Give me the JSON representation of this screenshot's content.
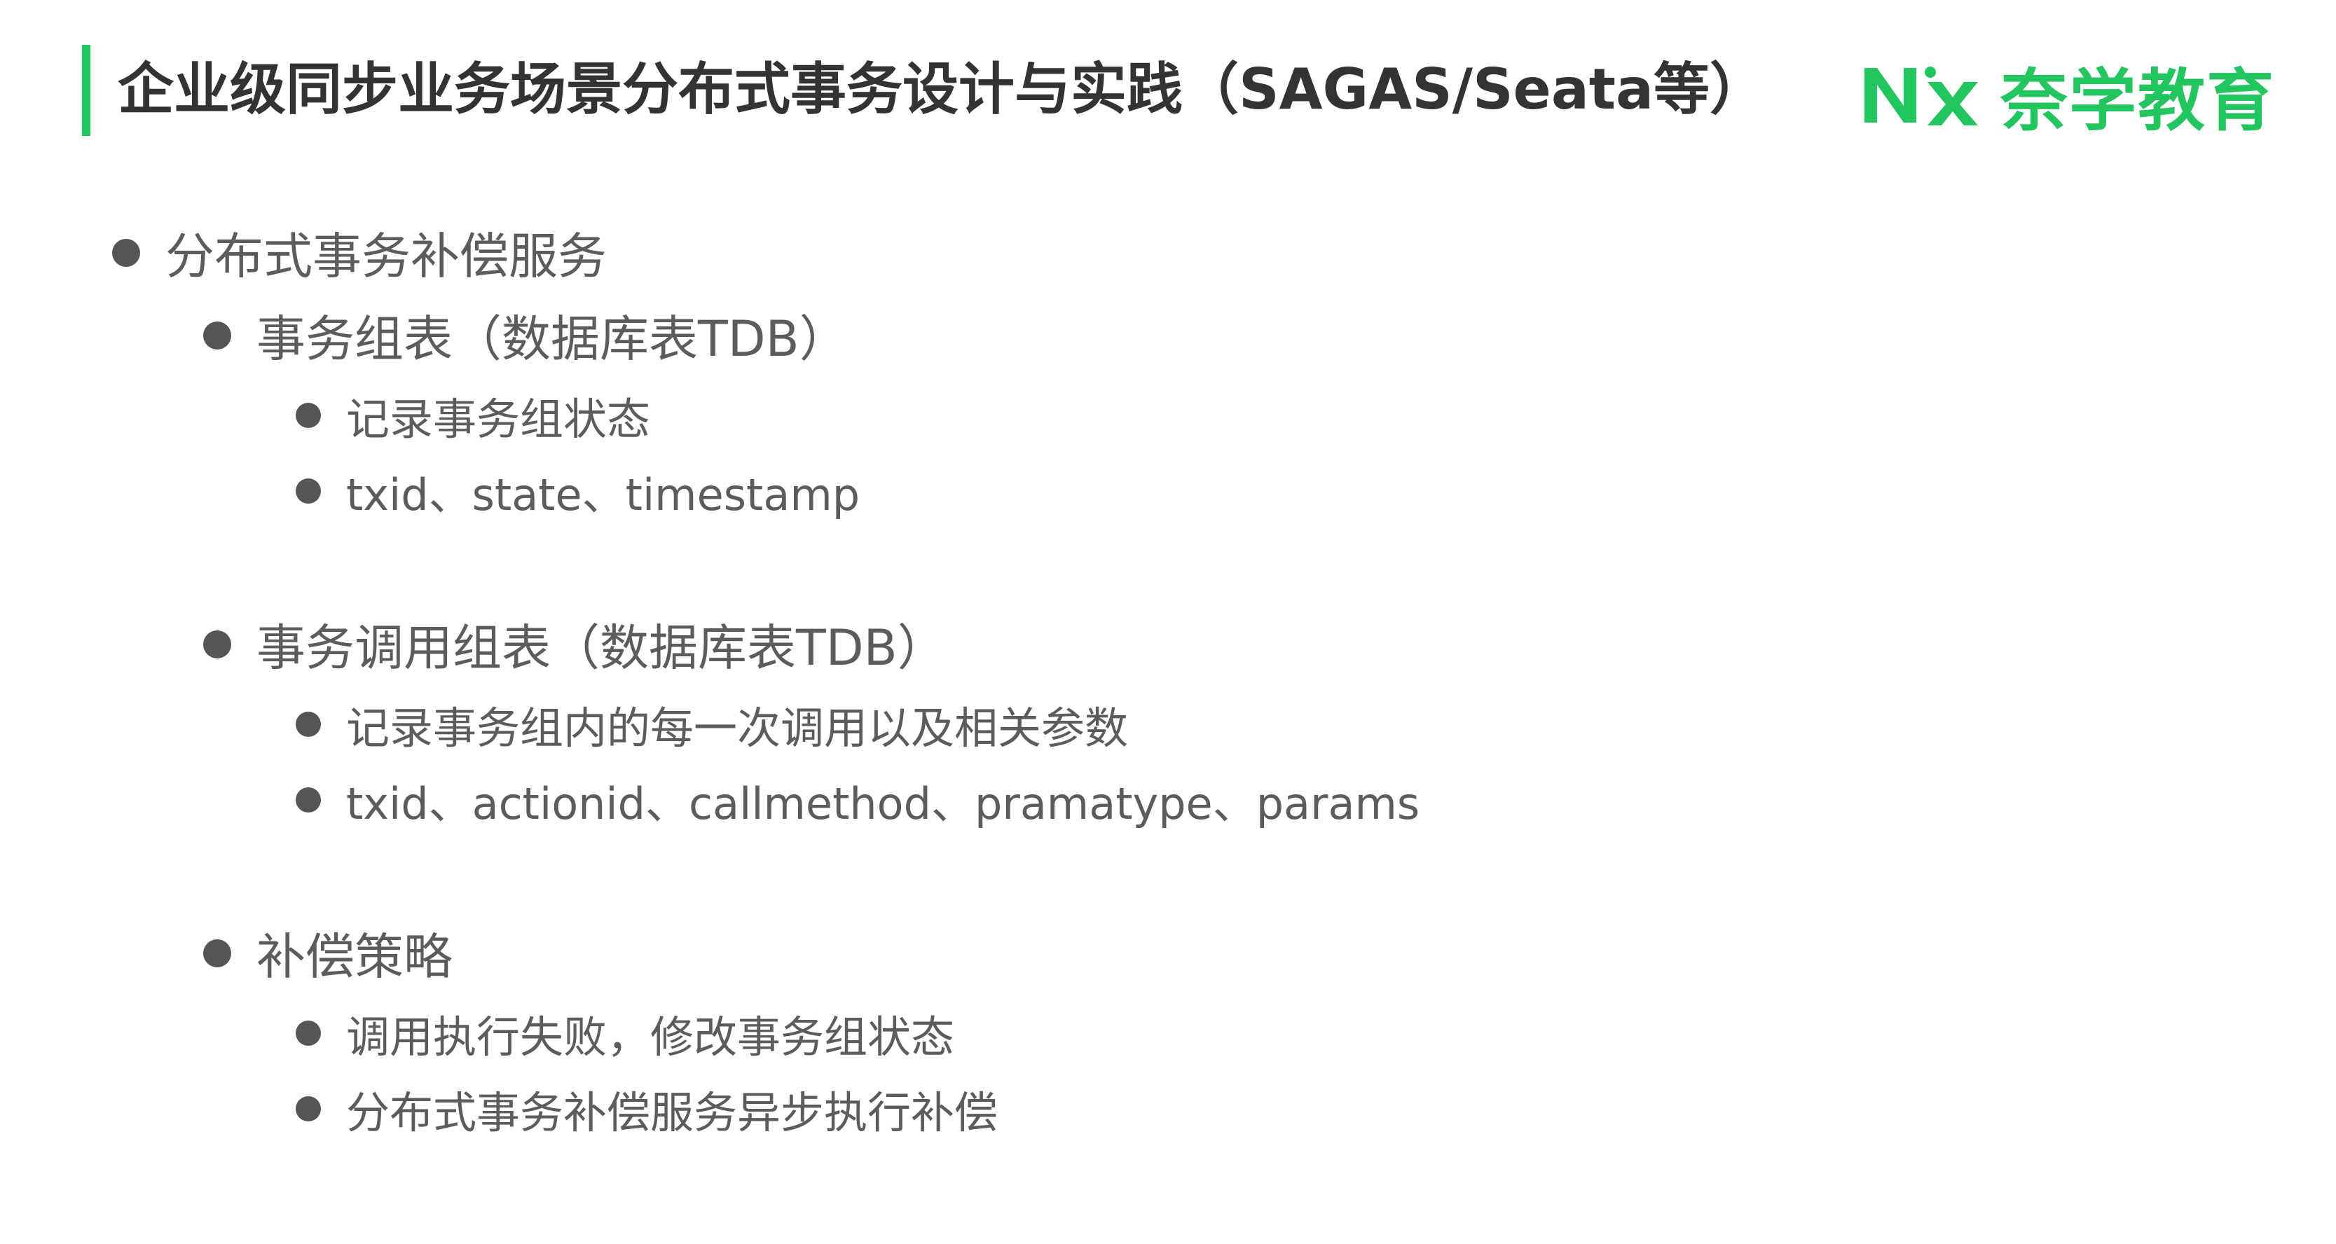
{
  "header": {
    "title": "企业级同步业务场景分布式事务设计与实践（SAGAS/Seata等）",
    "logo_mark": "NX",
    "logo_text": "奈学教育",
    "accent_color": "#22c55e"
  },
  "outline": {
    "l1": "分布式事务补偿服务",
    "g1": {
      "heading": "事务组表（数据库表TDB）",
      "items": [
        "记录事务组状态",
        "txid、state、timestamp"
      ]
    },
    "g2": {
      "heading": "事务调用组表（数据库表TDB）",
      "items": [
        "记录事务组内的每一次调用以及相关参数",
        "txid、actionid、callmethod、pramatype、params"
      ]
    },
    "g3": {
      "heading": "补偿策略",
      "items": [
        "调用执行失败，修改事务组状态",
        "分布式事务补偿服务异步执行补偿"
      ]
    }
  }
}
